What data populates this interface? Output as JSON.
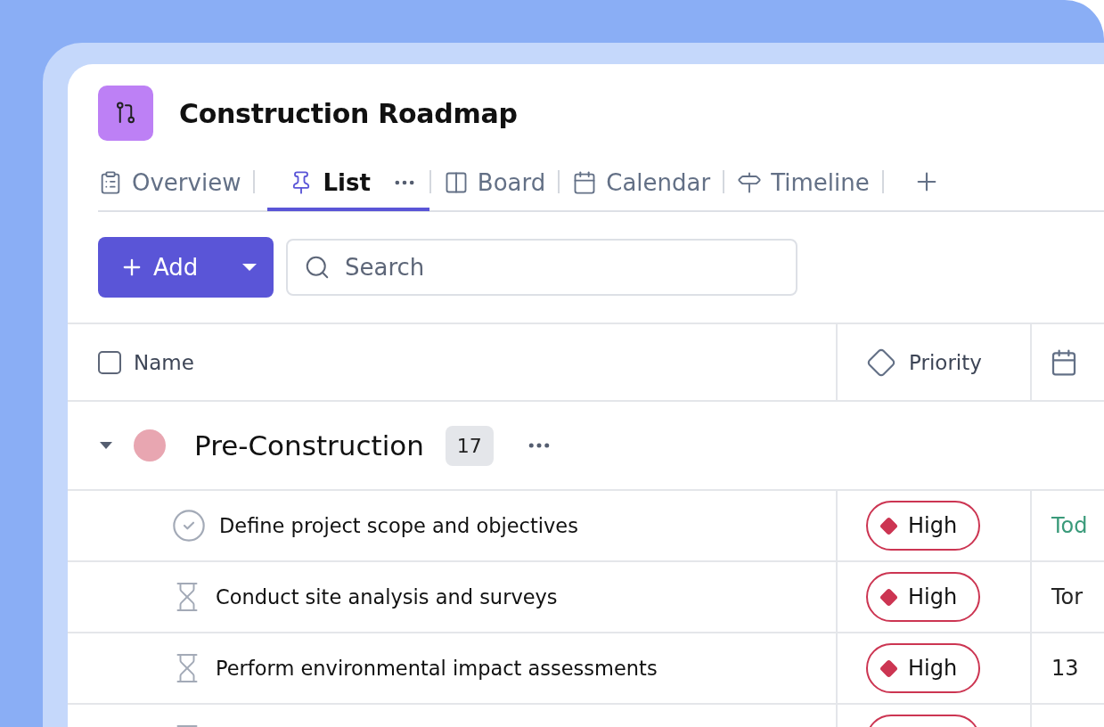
{
  "project": {
    "title": "Construction Roadmap"
  },
  "tabs": [
    {
      "label": "Overview",
      "selected": false
    },
    {
      "label": "List",
      "selected": true
    },
    {
      "label": "Board",
      "selected": false
    },
    {
      "label": "Calendar",
      "selected": false
    },
    {
      "label": "Timeline",
      "selected": false
    }
  ],
  "toolbar": {
    "add_button": "Add",
    "search": {
      "placeholder": "Search"
    }
  },
  "table": {
    "select_all": {
      "checked": false
    },
    "columns": [
      {
        "label": "Name"
      },
      {
        "label": "Priority"
      }
    ],
    "group": {
      "title": "Pre-Construction",
      "count": "17",
      "color": "#e8a6b1",
      "expanded": true
    },
    "rows": [
      {
        "done": true,
        "name": "Define project scope and objectives",
        "priority": {
          "kind": "high",
          "label": "High"
        },
        "date": {
          "text": "Tod",
          "today": true
        }
      },
      {
        "done": false,
        "name": "Conduct site analysis and surveys",
        "priority": {
          "kind": "high",
          "label": "High"
        },
        "date": {
          "text": "Tor",
          "today": false
        }
      },
      {
        "done": false,
        "name": "Perform environmental impact assessments",
        "priority": {
          "kind": "high",
          "label": "High"
        },
        "date": {
          "text": "13",
          "today": false
        }
      },
      {
        "done": false,
        "priority": {
          "kind": "high"
        }
      }
    ]
  }
}
